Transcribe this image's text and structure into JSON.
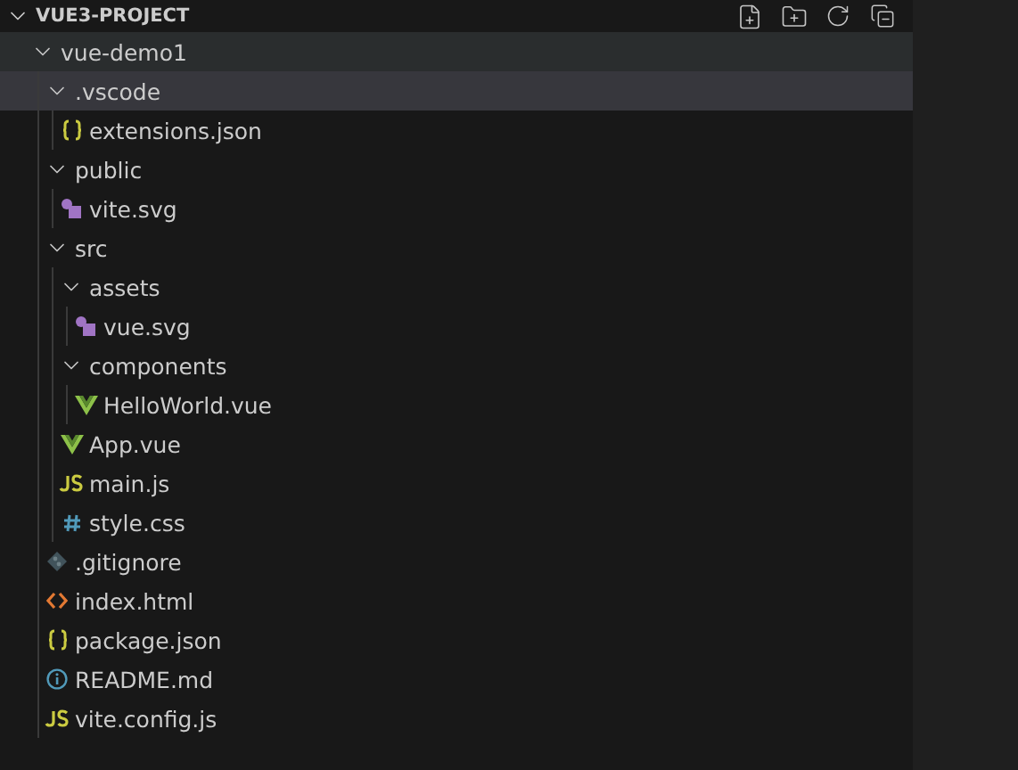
{
  "explorer": {
    "title": "VUE3-PROJECT",
    "expanded": true,
    "tree": [
      {
        "label": "vue-demo1",
        "kind": "folder",
        "expanded": true,
        "selected": false,
        "hovered": true,
        "children": [
          {
            "label": ".vscode",
            "kind": "folder",
            "expanded": true,
            "selected": true,
            "hovered": false,
            "children": [
              {
                "label": "extensions.json",
                "kind": "json",
                "selected": false,
                "hovered": false
              }
            ]
          },
          {
            "label": "public",
            "kind": "folder",
            "expanded": true,
            "selected": false,
            "hovered": false,
            "children": [
              {
                "label": "vite.svg",
                "kind": "svg",
                "selected": false,
                "hovered": false
              }
            ]
          },
          {
            "label": "src",
            "kind": "folder",
            "expanded": true,
            "selected": false,
            "hovered": false,
            "children": [
              {
                "label": "assets",
                "kind": "folder",
                "expanded": true,
                "selected": false,
                "hovered": false,
                "children": [
                  {
                    "label": "vue.svg",
                    "kind": "svg",
                    "selected": false,
                    "hovered": false
                  }
                ]
              },
              {
                "label": "components",
                "kind": "folder",
                "expanded": true,
                "selected": false,
                "hovered": false,
                "children": [
                  {
                    "label": "HelloWorld.vue",
                    "kind": "vue",
                    "selected": false,
                    "hovered": false
                  }
                ]
              },
              {
                "label": "App.vue",
                "kind": "vue",
                "selected": false,
                "hovered": false
              },
              {
                "label": "main.js",
                "kind": "js",
                "selected": false,
                "hovered": false
              },
              {
                "label": "style.css",
                "kind": "css",
                "selected": false,
                "hovered": false
              }
            ]
          },
          {
            "label": ".gitignore",
            "kind": "git",
            "selected": false,
            "hovered": false
          },
          {
            "label": "index.html",
            "kind": "html",
            "selected": false,
            "hovered": false
          },
          {
            "label": "package.json",
            "kind": "json",
            "selected": false,
            "hovered": false
          },
          {
            "label": "README.md",
            "kind": "info",
            "selected": false,
            "hovered": false
          },
          {
            "label": "vite.config.js",
            "kind": "js",
            "selected": false,
            "hovered": false
          }
        ]
      }
    ]
  }
}
